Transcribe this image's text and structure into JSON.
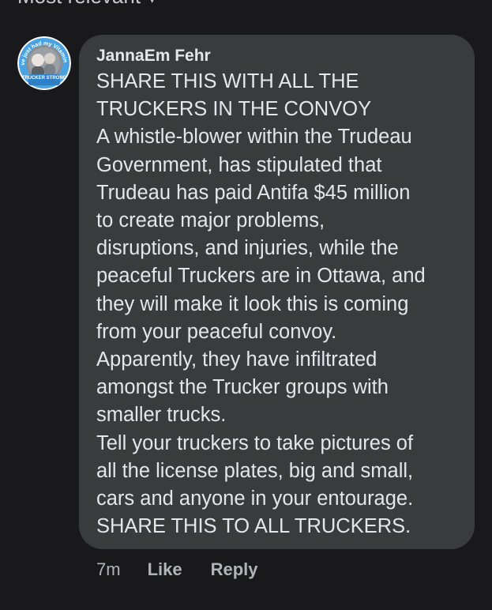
{
  "sort": {
    "label": "Most relevant"
  },
  "comment": {
    "author": "JannaEm Fehr",
    "avatar": {
      "badge_top_text": "I've just had my Vitamin D",
      "badge_bottom_text": "TRUCKER STRONG"
    },
    "lines": [
      "SHARE THIS WITH ALL THE",
      "TRUCKERS IN THE CONVOY",
      "A whistle-blower within the Trudeau",
      "Government, has stipulated that",
      "Trudeau has paid Antifa $45 million",
      "to create major problems,",
      "disruptions, and injuries, while the",
      "peaceful Truckers are in Ottawa, and",
      "they will make it look this is coming",
      "from your peaceful convoy.",
      "Apparently, they have infiltrated",
      "amongst the Trucker groups with",
      "smaller trucks.",
      "Tell your truckers to take pictures of",
      "all the license plates, big and small,",
      "cars and anyone in your entourage.",
      "SHARE THIS TO ALL TRUCKERS."
    ]
  },
  "actions": {
    "time": "7m",
    "like_label": "Like",
    "reply_label": "Reply"
  },
  "colors": {
    "background": "#19191b",
    "bubble": "#3a3b3c",
    "text": "#e4e6eb",
    "muted": "#b0b3b8",
    "badge_ring": "#4aa3e0"
  }
}
